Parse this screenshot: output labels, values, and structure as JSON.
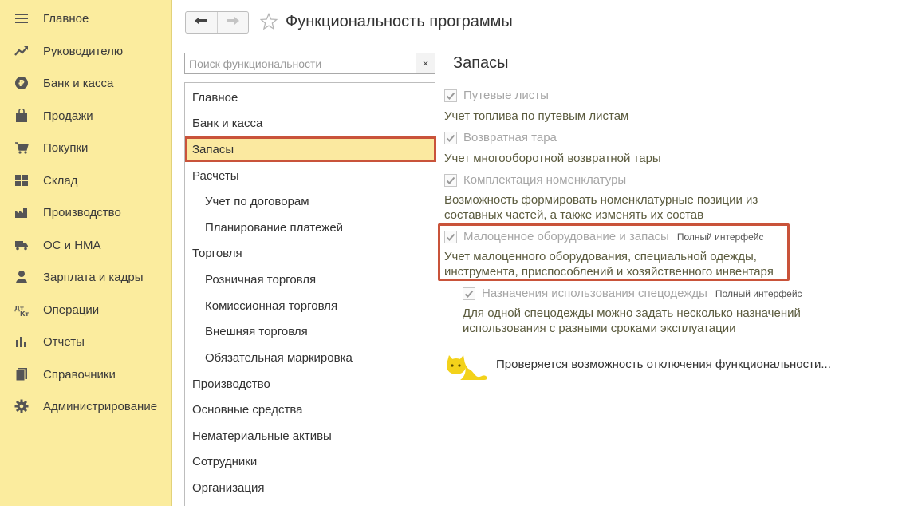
{
  "sidebar": {
    "items": [
      {
        "label": "Главное",
        "icon": "menu-icon"
      },
      {
        "label": "Руководителю",
        "icon": "trend-icon"
      },
      {
        "label": "Банк и касса",
        "icon": "ruble-icon"
      },
      {
        "label": "Продажи",
        "icon": "bag-icon"
      },
      {
        "label": "Покупки",
        "icon": "cart-icon"
      },
      {
        "label": "Склад",
        "icon": "warehouse-icon"
      },
      {
        "label": "Производство",
        "icon": "factory-icon"
      },
      {
        "label": "ОС и НМА",
        "icon": "truck-icon"
      },
      {
        "label": "Зарплата и кадры",
        "icon": "person-icon"
      },
      {
        "label": "Операции",
        "icon": "operations-icon"
      },
      {
        "label": "Отчеты",
        "icon": "bar-chart-icon"
      },
      {
        "label": "Справочники",
        "icon": "book-icon"
      },
      {
        "label": "Администрирование",
        "icon": "gear-icon"
      }
    ]
  },
  "header": {
    "back_icon": "arrow-left-icon",
    "forward_icon": "arrow-right-icon",
    "favorite_icon": "star-icon",
    "title": "Функциональность программы"
  },
  "search": {
    "placeholder": "Поиск функциональности",
    "value": "",
    "clear_label": "×"
  },
  "sections": {
    "items": [
      {
        "label": "Главное",
        "level": 0
      },
      {
        "label": "Банк и касса",
        "level": 0
      },
      {
        "label": "Запасы",
        "level": 0,
        "selected": true
      },
      {
        "label": "Расчеты",
        "level": 0
      },
      {
        "label": "Учет по договорам",
        "level": 1
      },
      {
        "label": "Планирование платежей",
        "level": 1
      },
      {
        "label": "Торговля",
        "level": 0
      },
      {
        "label": "Розничная торговля",
        "level": 1
      },
      {
        "label": "Комиссионная торговля",
        "level": 1
      },
      {
        "label": "Внешняя торговля",
        "level": 1
      },
      {
        "label": "Обязательная маркировка",
        "level": 1
      },
      {
        "label": "Производство",
        "level": 0
      },
      {
        "label": "Основные средства",
        "level": 0
      },
      {
        "label": "Нематериальные активы",
        "level": 0
      },
      {
        "label": "Сотрудники",
        "level": 0
      },
      {
        "label": "Организация",
        "level": 0
      }
    ]
  },
  "content": {
    "title": "Запасы",
    "options": [
      {
        "label": "Путевые листы",
        "checked": true,
        "badge": "",
        "desc": "Учет топлива по путевым листам"
      },
      {
        "label": "Возвратная тара",
        "checked": true,
        "badge": "",
        "desc": "Учет многооборотной возвратной тары"
      },
      {
        "label": "Комплектация номенклатуры",
        "checked": true,
        "badge": "",
        "desc": "Возможность формировать номенклатурные позиции из составных частей, а также изменять их состав"
      },
      {
        "label": "Малоценное оборудование и запасы",
        "checked": true,
        "badge": "Полный интерфейс",
        "desc": "Учет малоценного оборудования, специальной одежды, инструмента, приспособлений и хозяйственного инвентаря"
      },
      {
        "label": "Назначения использования спецодежды",
        "checked": true,
        "badge": "Полный интерфейс",
        "desc": "Для одной спецодежды можно задать несколько назначений использования с разными сроками эксплуатации"
      }
    ],
    "status": "Проверяется возможность отключения функциональности..."
  },
  "colors": {
    "sidebar_bg": "#fbec9e",
    "selected_bg": "#fbe9a0",
    "highlight_border": "#c9533a",
    "checkbox_check": "#9a9a9a"
  }
}
